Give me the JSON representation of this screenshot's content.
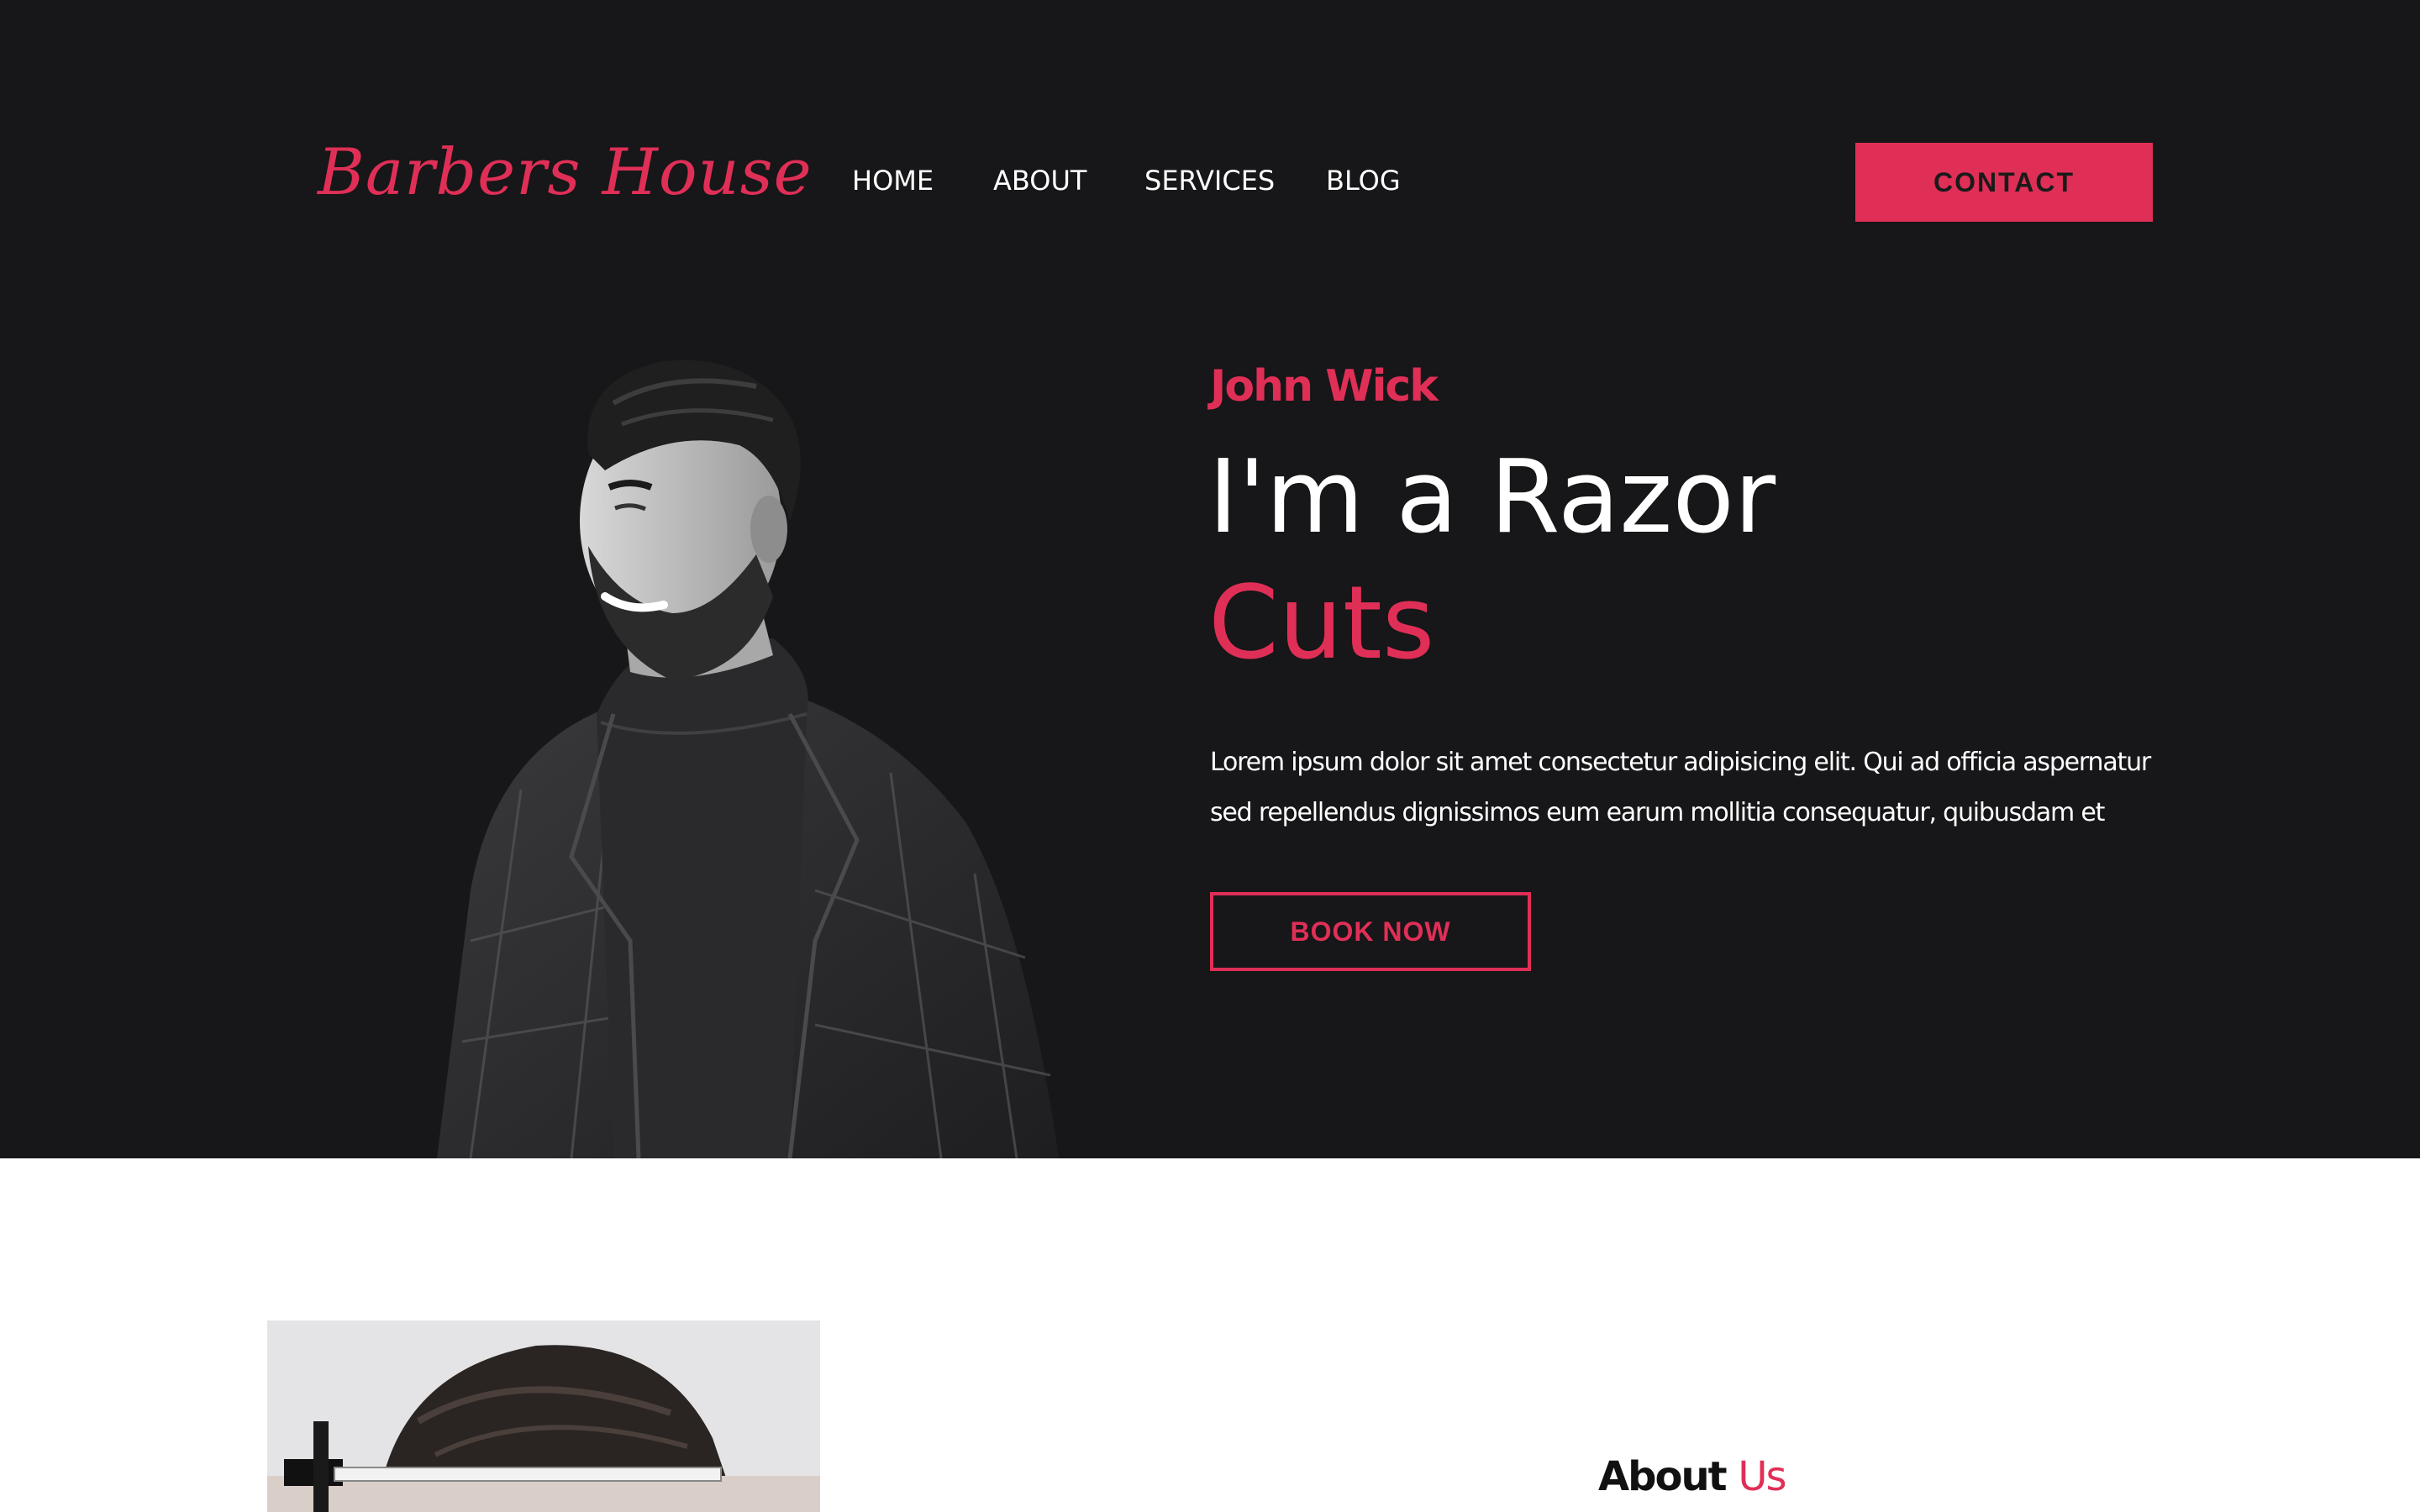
{
  "brand": {
    "logo_text": "Barbers House",
    "accent_color": "#e02f57",
    "background_color": "#171618"
  },
  "nav": {
    "items": [
      {
        "label": "HOME"
      },
      {
        "label": "ABOUT"
      },
      {
        "label": "SERVICES"
      },
      {
        "label": "BLOG"
      }
    ],
    "contact_label": "CONTACT"
  },
  "hero": {
    "name": "John Wick",
    "headline_line1": "I'm a Razor",
    "headline_line2": "Cuts",
    "description": "Lorem ipsum dolor sit amet consectetur adipisicing elit. Qui ad officia aspernatur sed repellendus dignissimos eum earum mollitia consequatur, quibusdam et",
    "cta_label": "BOOK NOW",
    "image": "barber-portrait"
  },
  "about": {
    "title_part1": "About",
    "title_part2": "Us",
    "image": "razor-haircut-photo"
  }
}
